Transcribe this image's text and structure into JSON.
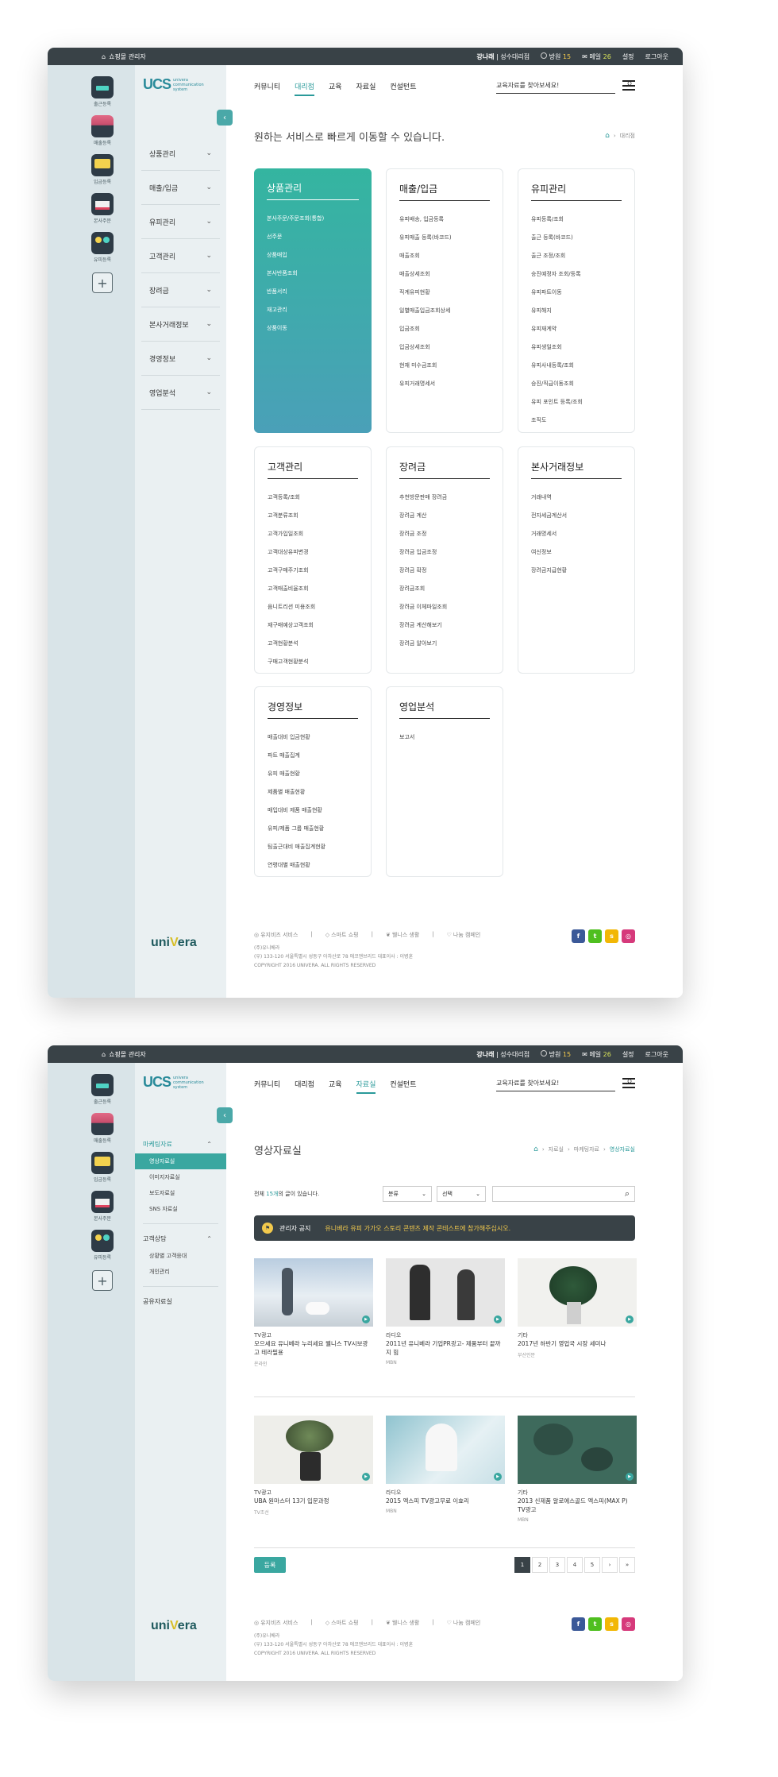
{
  "topbar": {
    "shop_admin": "쇼핑몰 관리자",
    "user_name": "강나래",
    "user_store": "성수대리점",
    "point_label": "방원",
    "point_value": "15",
    "mail_label": "메일",
    "mail_value": "26",
    "settings": "설정",
    "logout": "로그아웃"
  },
  "apps": [
    {
      "label": "출근등록",
      "icon": "briefcase-icon"
    },
    {
      "label": "매출등록",
      "icon": "sales-icon"
    },
    {
      "label": "입금등록",
      "icon": "deposit-icon"
    },
    {
      "label": "본사주문",
      "icon": "order-icon"
    },
    {
      "label": "유피등록",
      "icon": "people-icon"
    }
  ],
  "logo": {
    "main": "UCS",
    "sub1": "univera",
    "sub2": "communication",
    "sub3": "system"
  },
  "nav": [
    "커뮤니티",
    "대리점",
    "교육",
    "자료실",
    "컨설턴트"
  ],
  "search_placeholder": "교육자료를 찾아보세요!",
  "page1": {
    "menu": [
      "상품관리",
      "매출/입금",
      "유피관리",
      "고객관리",
      "장려금",
      "본사거래정보",
      "경영정보",
      "영업분석"
    ],
    "title": "원하는 서비스로 빠르게 이동할 수 있습니다.",
    "breadcrumb": "대리점",
    "cards": [
      {
        "title": "상품관리",
        "items": [
          "본사주문/주문조회(통합)",
          "선주문",
          "상품매입",
          "본사반품조회",
          "반품서리",
          "재고관리",
          "상품이동"
        ]
      },
      {
        "title": "매출/입금",
        "items": [
          "유피배송, 입금등록",
          "유피매출 등록(바코드)",
          "매출조회",
          "매출상세조회",
          "직계유피현황",
          "일별매출입금조회상세",
          "입금조회",
          "입금상세조회",
          "현재 미수금조회",
          "유피거래명세서"
        ]
      },
      {
        "title": "유피관리",
        "items": [
          "유피등록/조회",
          "출근 등록(바코드)",
          "출근 조정/조회",
          "승진예정자 조회/등록",
          "유피파트이동",
          "유피해지",
          "유피재계약",
          "유피생일조회",
          "유피사내등록/조회",
          "승진/직급이동조회",
          "유피 포인트 등록/조회",
          "조직도"
        ]
      },
      {
        "title": "고객관리",
        "items": [
          "고객등록/조회",
          "고객분류조회",
          "고객가입일조회",
          "고객대상유피변경",
          "고객구매주기조회",
          "고객매출비율조회",
          "음니트리션 미용조회",
          "재구매예상고객조회",
          "고객현황분석",
          "구매고객현황분석"
        ]
      },
      {
        "title": "장려금",
        "items": [
          "추천방문판매 장려금",
          "장려금 계산",
          "장려금 조정",
          "장려금 입금조정",
          "장려금 확정",
          "장려금조회",
          "장려금 이체파일조회",
          "장려금 계산해보기",
          "장려금 알아보기"
        ]
      },
      {
        "title": "본사거래정보",
        "items": [
          "거래내역",
          "전자세금계산서",
          "거래명세서",
          "여신정보",
          "장려금지급현황"
        ]
      },
      {
        "title": "경영정보",
        "items": [
          "매출대비 입금현황",
          "파트 매출집계",
          "유피 매출현황",
          "제품별 매출현황",
          "매입대비 제품 매출현황",
          "유피/제품 그룹 매출현황",
          "팀출근대비 매출집계현황",
          "연령대별 매출현황"
        ]
      },
      {
        "title": "영업분석",
        "items": [
          "보고서"
        ]
      }
    ]
  },
  "page2": {
    "sub_groups": [
      {
        "label": "마케팅자료",
        "items": [
          "영상자료실",
          "이미지자료실",
          "보도자료실",
          "SNS 자료실"
        ]
      },
      {
        "label": "고객상담",
        "items": [
          "상황별 고객응대",
          "개인관리"
        ]
      },
      {
        "label": "공유자료실",
        "items": []
      }
    ],
    "title": "영상자료실",
    "breadcrumb": [
      "자료실",
      "마케팅자료",
      "영상자료실"
    ],
    "count_pre": "전체 ",
    "count_num": "15개",
    "count_post": "의 글이 있습니다.",
    "filter1": "분류",
    "filter2": "선택",
    "notice_label": "관리자 공지",
    "notice_msg": "유니베라 유피 가가오 스토리 콘텐츠 제작 콘테스트에 참가해주십시오.",
    "videos": [
      {
        "cat": "TV광고",
        "title": "모으세요 유니베라 누리세요 웰니스 TV시보광고 테라필용",
        "src": "온라인"
      },
      {
        "cat": "라디오",
        "title": "2011년 유니베라 기업PR광고- 제품부터 끝까지 힘",
        "src": "MBN"
      },
      {
        "cat": "기타",
        "title": "2017년 하반기 영업국 시장 세미나",
        "src": "부산인문"
      },
      {
        "cat": "TV광고",
        "title": "UBA 원마스터 13기 입문과정",
        "src": "TV조선"
      },
      {
        "cat": "라디오",
        "title": "2015 엑스피 TV광고무료 이효리",
        "src": "MBN"
      },
      {
        "cat": "기타",
        "title": "2013 신제품 알로에스골드 엑스피(MAX P) TV광고",
        "src": "MBN"
      }
    ],
    "register": "등록",
    "pages": [
      "1",
      "2",
      "3",
      "4",
      "5",
      "›",
      "»"
    ]
  },
  "footer": {
    "links": [
      "유지비즈 서비스",
      "스마트 쇼핑",
      "웰니스 생활",
      "나눔 캠페인"
    ],
    "company": "(주)유니베라",
    "address": "(우) 133-120 서울특별시 성동구 아차산로 78 에코앤브리드  대표이사 : 이병훈",
    "copyright": "COPYRIGHT 2016 UNIVERA. ALL RIGHTS RESERVED"
  },
  "brand": {
    "pre": "uni",
    "mid": "V",
    "post": "era"
  },
  "colors": {
    "accent": "#3aa7a0",
    "dark": "#394247",
    "sidebar": "#d9e4e8"
  }
}
